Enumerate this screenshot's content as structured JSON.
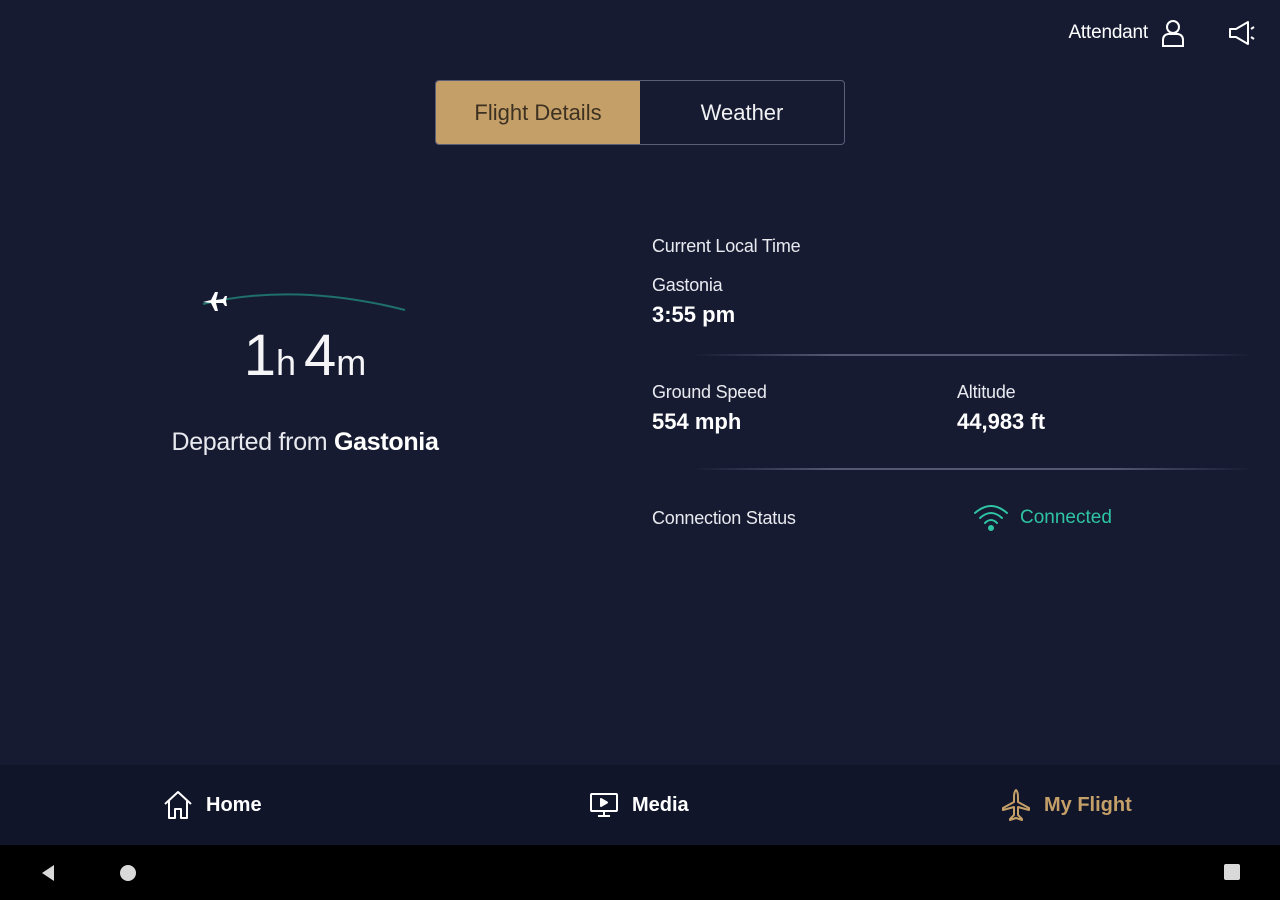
{
  "header": {
    "attendant_label": "Attendant",
    "attendant_icon": "person-icon",
    "announcement_icon": "megaphone-icon"
  },
  "tabs": [
    {
      "label": "Flight Details",
      "active": true
    },
    {
      "label": "Weather",
      "active": false
    }
  ],
  "flight_progress": {
    "hours": "1",
    "hours_unit": "h",
    "minutes": "4",
    "minutes_unit": "m",
    "departed_prefix": "Departed from",
    "departed_city": "Gastonia"
  },
  "flight_info": {
    "local_time_label": "Current Local Time",
    "local_time_city": "Gastonia",
    "local_time_value": "3:55 pm",
    "ground_speed_label": "Ground Speed",
    "ground_speed_value": "554 mph",
    "altitude_label": "Altitude",
    "altitude_value": "44,983 ft",
    "connection_label": "Connection Status",
    "connection_value": "Connected"
  },
  "nav": {
    "home": "Home",
    "media": "Media",
    "my_flight": "My Flight"
  },
  "colors": {
    "background": "#161b32",
    "accent_gold": "#c59f68",
    "connected_teal": "#2ec4a4",
    "nav_background": "#10152a"
  }
}
